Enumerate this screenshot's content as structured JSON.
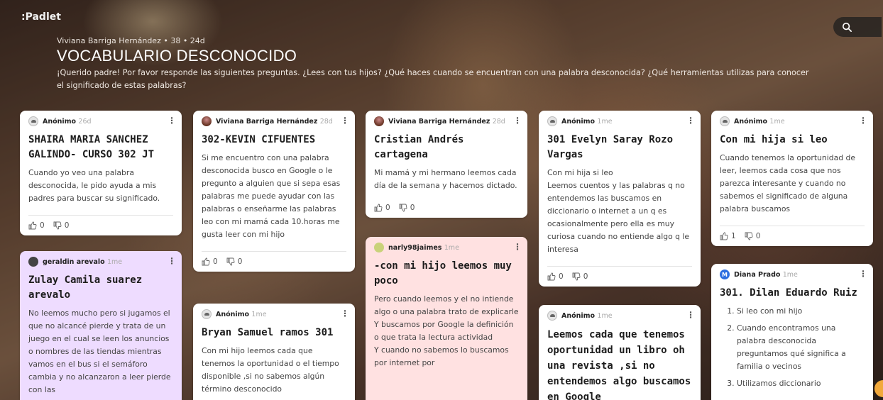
{
  "app": {
    "logo": ":Padlet"
  },
  "header": {
    "meta": "Viviana Barriga Hernández • 38 • 24d",
    "title": "VOCABULARIO DESCONOCIDO",
    "description": "¡Querido padre! Por favor responde las siguientes preguntas. ¿Lees con tus hijos? ¿Qué haces cuando se encuentran con una palabra desconocida? ¿Qué herramientas utilizas para conocer el significado de estas palabras?"
  },
  "icons": {
    "search": "search-icon",
    "like": "thumbs-up-icon",
    "dislike": "thumbs-down-icon",
    "more": "more-vertical-icon"
  },
  "colors": {
    "purple_card": "#eedcff",
    "pink_card": "#ffe1e1",
    "accent_orange": "#f2a93b"
  },
  "cards": [
    {
      "author": "Anónimo",
      "time": "26d",
      "title": "SHAIRA MARIA SANCHEZ GALINDO- CURSO 302 JT",
      "body": "Cuando yo veo una palabra desconocida, le pido ayuda a mis padres para buscar su significado.",
      "likes": "0",
      "dislikes": "0"
    },
    {
      "author": "geraldin arevalo",
      "time": "1me",
      "title": "Zulay Camila suarez arevalo",
      "body": "No leemos mucho pero si jugamos el que no alcancé pierde y trata de un juego en el cual se leen los anuncios o nombres de las tiendas mientras vamos en el bus si el semáforo cambia y no alcanzaron a leer pierde con las"
    },
    {
      "author": "Viviana Barriga Hernández",
      "time": "28d",
      "title": "302-KEVIN CIFUENTES",
      "body": "Si me encuentro con una palabra desconocida busco en Google o le pregunto a alguien que si sepa esas palabras me puede ayudar con las palabras o enseñarme las palabras leo con mi mamá cada 10.horas me gusta leer con mi hijo",
      "likes": "0",
      "dislikes": "0"
    },
    {
      "author": "Anónimo",
      "time": "1me",
      "title": "Bryan Samuel ramos 301",
      "body": "Con mi hijo leemos cada que tenemos la oportunidad o el tiempo disponible ,si no sabemos algún término desconocido"
    },
    {
      "author": "Viviana Barriga Hernández",
      "time": "28d",
      "title": "Cristian Andrés cartagena",
      "body": "Mi mamá y mi hermano leemos cada día de la semana y hacemos dictado.",
      "likes": "0",
      "dislikes": "0"
    },
    {
      "author": "narly98jaimes",
      "time": "1me",
      "title": "-con mi hijo leemos muy poco",
      "body": "Pero cuando leemos y el no intiende algo o una palabra trato de explicarle\nY buscamos por  Google la definición o que trata la lectura actividad\nY cuando no sabemos lo buscamos por internet por"
    },
    {
      "author": "Anónimo",
      "time": "1me",
      "title": "301 Evelyn Saray Rozo Vargas",
      "body": "Con mi hija si leo\nLeemos cuentos y las palabras q no entendemos las buscamos en diccionario o internet a un q es ocasionalmente pero ella es muy curiosa cuando no entiende algo q le interesa",
      "likes": "0",
      "dislikes": "0"
    },
    {
      "author": "Anónimo",
      "time": "1me",
      "title": "Leemos cada que tenemos oportunidad un libro oh una revista ,si no entendemos algo buscamos en Google",
      "body": ""
    },
    {
      "author": "Anónimo",
      "time": "1me",
      "title": "Con mi hija si leo",
      "body": "Cuando tenemos la oportunidad de leer, leemos cada cosa que nos parezca interesante y cuando no sabemos el significado de alguna palabra buscamos",
      "likes": "1",
      "dislikes": "0"
    },
    {
      "author": "Diana Prado",
      "time": "1me",
      "title": "301.   Dilan Eduardo Ruiz",
      "list": [
        "Si leo con mi hijo",
        "Cuando encontramos una palabra desconocida preguntamos qué significa a familia o vecinos",
        "Utilizamos  diccionario"
      ]
    }
  ]
}
